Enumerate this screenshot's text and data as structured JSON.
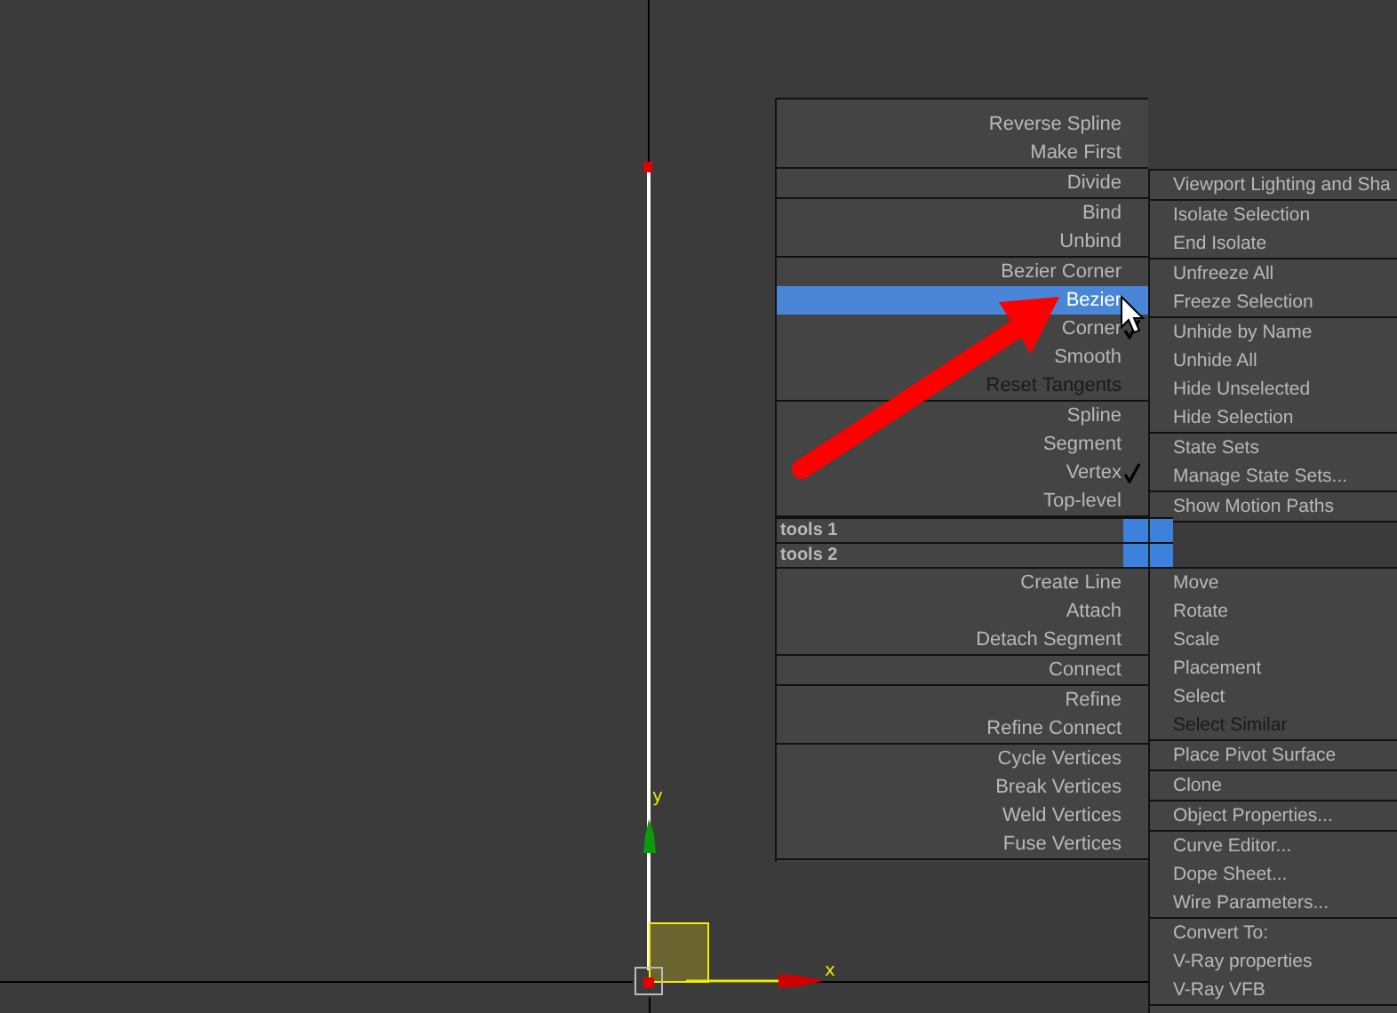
{
  "viewport": {
    "axis_labels": [
      {
        "label": "y",
        "kind": "y"
      },
      {
        "label": "x",
        "kind": "x"
      }
    ]
  },
  "quad_menu": {
    "top_left": [
      [
        {
          "label": "Reverse Spline",
          "checked": false,
          "disabled": false,
          "selected": false
        },
        {
          "label": "Make First",
          "checked": false,
          "disabled": false,
          "selected": false
        }
      ],
      [
        {
          "label": "Divide",
          "checked": false,
          "disabled": false,
          "selected": false
        }
      ],
      [
        {
          "label": "Bind",
          "checked": false,
          "disabled": false,
          "selected": false
        },
        {
          "label": "Unbind",
          "checked": false,
          "disabled": false,
          "selected": false
        }
      ],
      [
        {
          "label": "Bezier Corner",
          "checked": false,
          "disabled": false,
          "selected": false
        },
        {
          "label": "Bezier",
          "checked": false,
          "disabled": false,
          "selected": true
        },
        {
          "label": "Corner",
          "checked": true,
          "disabled": false,
          "selected": false
        },
        {
          "label": "Smooth",
          "checked": false,
          "disabled": false,
          "selected": false
        },
        {
          "label": "Reset Tangents",
          "checked": false,
          "disabled": true,
          "selected": false
        }
      ],
      [
        {
          "label": "Spline",
          "checked": false,
          "disabled": false,
          "selected": false
        },
        {
          "label": "Segment",
          "checked": false,
          "disabled": false,
          "selected": false
        },
        {
          "label": "Vertex",
          "checked": true,
          "disabled": false,
          "selected": false
        },
        {
          "label": "Top-level",
          "checked": false,
          "disabled": false,
          "selected": false
        }
      ]
    ],
    "top_right": [
      [
        {
          "label": "Viewport Lighting and Sha",
          "checked": false,
          "disabled": false,
          "selected": false
        }
      ],
      [
        {
          "label": "Isolate Selection",
          "checked": false,
          "disabled": false,
          "selected": false
        },
        {
          "label": "End Isolate",
          "checked": false,
          "disabled": false,
          "selected": false
        }
      ],
      [
        {
          "label": "Unfreeze All",
          "checked": false,
          "disabled": false,
          "selected": false
        },
        {
          "label": "Freeze Selection",
          "checked": false,
          "disabled": false,
          "selected": false
        }
      ],
      [
        {
          "label": "Unhide by Name",
          "checked": false,
          "disabled": false,
          "selected": false
        },
        {
          "label": "Unhide All",
          "checked": false,
          "disabled": false,
          "selected": false
        },
        {
          "label": "Hide Unselected",
          "checked": false,
          "disabled": false,
          "selected": false
        },
        {
          "label": "Hide Selection",
          "checked": false,
          "disabled": false,
          "selected": false
        }
      ],
      [
        {
          "label": "State Sets",
          "checked": false,
          "disabled": false,
          "selected": false
        },
        {
          "label": "Manage State Sets...",
          "checked": false,
          "disabled": false,
          "selected": false
        }
      ],
      [
        {
          "label": "Show Motion Paths",
          "checked": false,
          "disabled": false,
          "selected": false
        }
      ]
    ],
    "headers": [
      {
        "label": "tools 1"
      },
      {
        "label": "tools 2"
      }
    ],
    "bottom_left": [
      [
        {
          "label": "Create Line",
          "checked": false,
          "disabled": false,
          "selected": false
        },
        {
          "label": "Attach",
          "checked": false,
          "disabled": false,
          "selected": false
        },
        {
          "label": "Detach Segment",
          "checked": false,
          "disabled": false,
          "selected": false
        }
      ],
      [
        {
          "label": "Connect",
          "checked": false,
          "disabled": false,
          "selected": false
        }
      ],
      [
        {
          "label": "Refine",
          "checked": false,
          "disabled": false,
          "selected": false
        },
        {
          "label": "Refine Connect",
          "checked": false,
          "disabled": false,
          "selected": false
        }
      ],
      [
        {
          "label": "Cycle Vertices",
          "checked": false,
          "disabled": false,
          "selected": false
        },
        {
          "label": "Break Vertices",
          "checked": false,
          "disabled": false,
          "selected": false
        },
        {
          "label": "Weld Vertices",
          "checked": false,
          "disabled": false,
          "selected": false
        },
        {
          "label": "Fuse Vertices",
          "checked": false,
          "disabled": false,
          "selected": false
        }
      ]
    ],
    "bottom_right": [
      [
        {
          "label": "Move",
          "checked": false,
          "disabled": false,
          "selected": false
        },
        {
          "label": "Rotate",
          "checked": false,
          "disabled": false,
          "selected": false
        },
        {
          "label": "Scale",
          "checked": false,
          "disabled": false,
          "selected": false
        },
        {
          "label": "Placement",
          "checked": false,
          "disabled": false,
          "selected": false
        },
        {
          "label": "Select",
          "checked": false,
          "disabled": false,
          "selected": false
        },
        {
          "label": "Select Similar",
          "checked": false,
          "disabled": true,
          "selected": false
        }
      ],
      [
        {
          "label": "Place Pivot Surface",
          "checked": false,
          "disabled": false,
          "selected": false
        }
      ],
      [
        {
          "label": "Clone",
          "checked": false,
          "disabled": false,
          "selected": false
        }
      ],
      [
        {
          "label": "Object Properties...",
          "checked": false,
          "disabled": false,
          "selected": false
        }
      ],
      [
        {
          "label": "Curve Editor...",
          "checked": false,
          "disabled": false,
          "selected": false
        },
        {
          "label": "Dope Sheet...",
          "checked": false,
          "disabled": false,
          "selected": false
        },
        {
          "label": "Wire Parameters...",
          "checked": false,
          "disabled": false,
          "selected": false
        }
      ],
      [
        {
          "label": "Convert To:",
          "checked": false,
          "disabled": false,
          "selected": false
        },
        {
          "label": "V-Ray properties",
          "checked": false,
          "disabled": false,
          "selected": false
        },
        {
          "label": "V-Ray VFB",
          "checked": false,
          "disabled": false,
          "selected": false
        }
      ]
    ]
  }
}
